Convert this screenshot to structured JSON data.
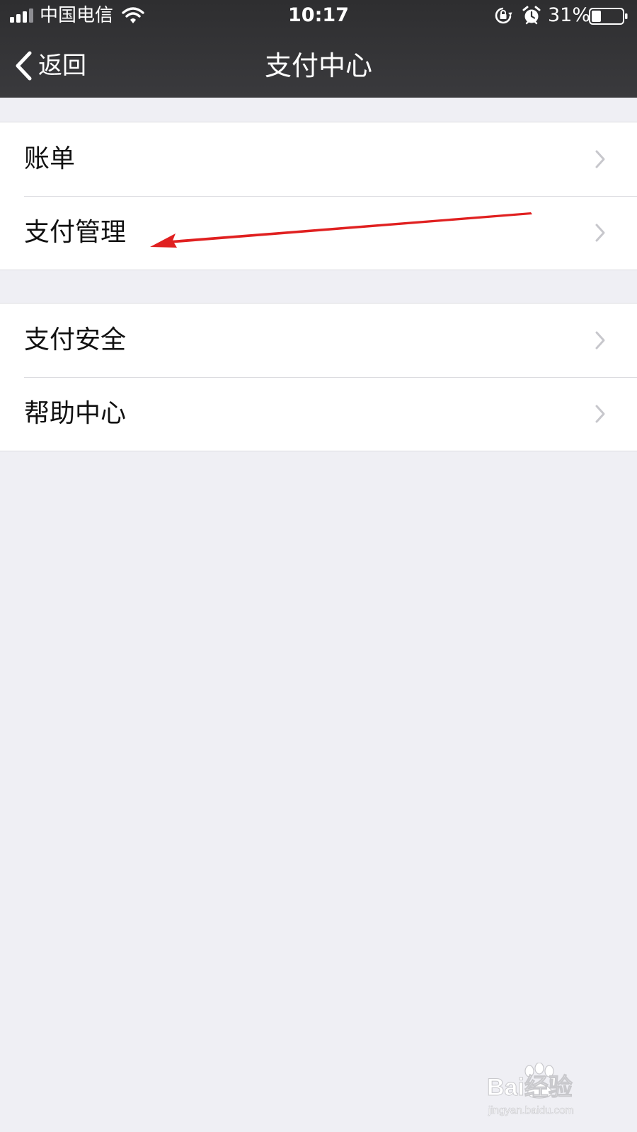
{
  "status_bar": {
    "carrier": "中国电信",
    "time": "10:17",
    "battery_percent": "31%",
    "battery_level": 0.31,
    "icons": [
      "signal-icon",
      "wifi-icon",
      "rotation-lock-icon",
      "alarm-icon",
      "battery-icon"
    ]
  },
  "nav": {
    "back_label": "返回",
    "title": "支付中心"
  },
  "menu": {
    "group1": [
      {
        "label": "账单"
      },
      {
        "label": "支付管理"
      }
    ],
    "group2": [
      {
        "label": "支付安全"
      },
      {
        "label": "帮助中心"
      }
    ]
  },
  "colors": {
    "header_bg": "#333335",
    "page_bg": "#efeff4",
    "cell_bg": "#ffffff",
    "annotation_arrow": "#e02020",
    "chevron": "#c7c7cc"
  },
  "watermark": {
    "brand_text": "Bai经验",
    "url": "jingyan.baidu.com"
  }
}
